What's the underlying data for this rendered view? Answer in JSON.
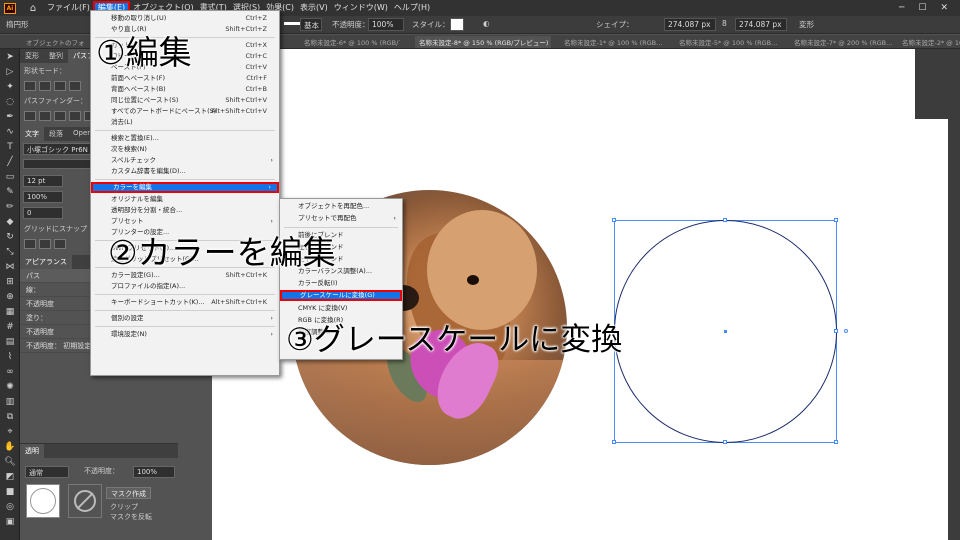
{
  "menubar": {
    "app_logo": "Ai",
    "items": [
      "ファイル(F)",
      "編集(E)",
      "オブジェクト(O)",
      "書式(T)",
      "選択(S)",
      "効果(C)",
      "表示(V)",
      "ウィンドウ(W)",
      "ヘルプ(H)"
    ],
    "active_index": 1
  },
  "controlbar": {
    "left_label": "楕円形",
    "stroke_type": "基本",
    "opacity_label": "不透明度：",
    "opacity_value": "100%",
    "style_label": "スタイル：",
    "shape_label": "シェイプ：",
    "width_value": "274.087 px",
    "height_value": "274.087 px",
    "transform_label": "変形"
  },
  "doc_tabs": [
    "オブジェクトのフォト...",
    "名称未設定-6* @ 100 % (RGB/プ...",
    "名称未設定-8* @ 150 % (RGB/プレビュー)",
    "名称未設定-1* @ 100 % (RGB...",
    "名称未設定-5* @ 100 % (RGB...",
    "名称未設定-7* @ 200 % (RGB...",
    "名称未設定-2* @ 100 % (RGB..."
  ],
  "left_panel": {
    "tabs": [
      "変形",
      "整列",
      "パスファ"
    ],
    "shape_mode_label": "形状モード：",
    "pathfinder_label": "パスファインダー：",
    "type_tabs": [
      "文字",
      "段落",
      "Open"
    ],
    "font_name": "小塚ゴシック Pr6N",
    "font_size": "12 pt",
    "scale": "100%",
    "tracking": "0",
    "snap_label": "グリッドにスナップ",
    "appearance_tab": "アピアランス",
    "appearance_rows": [
      {
        "label": "パス",
        "kind": "header"
      },
      {
        "label": "線：",
        "kind": "row"
      },
      {
        "label": "不透明度",
        "kind": "row"
      },
      {
        "label": "塗り：",
        "kind": "row"
      },
      {
        "label": "不透明度",
        "kind": "row"
      },
      {
        "label": "不透明度：  初期設定",
        "kind": "row"
      }
    ],
    "transparency_tab": "透明",
    "blend_mode": "通常",
    "transparency_opacity_label": "不透明度：",
    "transparency_opacity_value": "100%",
    "mask_button": "マスク作成",
    "clip_label": "クリップ",
    "invert_label": "マスクを反転"
  },
  "edit_menu": {
    "items": [
      {
        "label": "移動の取り消し(U)",
        "shortcut": "Ctrl+Z"
      },
      {
        "label": "やり直し(R)",
        "shortcut": "Shift+Ctrl+Z"
      },
      {
        "sep": true
      },
      {
        "label": "カット(T)",
        "shortcut": "Ctrl+X"
      },
      {
        "label": "コピー(C)",
        "shortcut": "Ctrl+C"
      },
      {
        "label": "ペースト(P)",
        "shortcut": "Ctrl+V"
      },
      {
        "label": "前面へペースト(F)",
        "shortcut": "Ctrl+F"
      },
      {
        "label": "背面へペースト(B)",
        "shortcut": "Ctrl+B"
      },
      {
        "label": "同じ位置にペースト(S)",
        "shortcut": "Shift+Ctrl+V"
      },
      {
        "label": "すべてのアートボードにペースト(S)",
        "shortcut": "Alt+Shift+Ctrl+V"
      },
      {
        "label": "消去(L)",
        "shortcut": ""
      },
      {
        "sep": true
      },
      {
        "label": "検索と置換(E)...",
        "shortcut": ""
      },
      {
        "label": "次を検索(N)",
        "shortcut": ""
      },
      {
        "label": "スペルチェック",
        "shortcut": "",
        "submenu": true
      },
      {
        "label": "カスタム辞書を編集(D)...",
        "shortcut": ""
      },
      {
        "sep": true
      },
      {
        "label": "カラーを編集",
        "shortcut": "",
        "submenu": true,
        "highlighted": true
      },
      {
        "label": "オリジナルを編集",
        "shortcut": ""
      },
      {
        "label": "透明部分を分割・統合...",
        "shortcut": ""
      },
      {
        "label": "プリセット",
        "shortcut": "",
        "submenu": true
      },
      {
        "label": "プリンターの設定...",
        "shortcut": ""
      },
      {
        "sep": true
      },
      {
        "label": "SWF プリセット(S)...",
        "shortcut": ""
      },
      {
        "label": "遠近グリッドプリセット(G)...",
        "shortcut": ""
      },
      {
        "sep": true
      },
      {
        "label": "カラー設定(G)...",
        "shortcut": "Shift+Ctrl+K"
      },
      {
        "label": "プロファイルの指定(A)...",
        "shortcut": ""
      },
      {
        "sep": true
      },
      {
        "label": "キーボードショートカット(K)...",
        "shortcut": "Alt+Shift+Ctrl+K"
      },
      {
        "sep": true
      },
      {
        "label": "個別の設定",
        "shortcut": "",
        "submenu": true
      },
      {
        "sep": true
      },
      {
        "label": "環境設定(N)",
        "shortcut": "",
        "submenu": true
      }
    ]
  },
  "color_submenu": {
    "items": [
      {
        "label": "オブジェクトを再配色..."
      },
      {
        "label": "プリセットで再配色",
        "submenu": true
      },
      {
        "sep": true
      },
      {
        "label": "前後にブレンド"
      },
      {
        "label": "左右にブレンド"
      },
      {
        "label": "上下にブレンド"
      },
      {
        "label": "カラーバランス調整(A)..."
      },
      {
        "label": "カラー反転(I)"
      },
      {
        "label": "グレースケールに変換(G)",
        "highlighted": true
      },
      {
        "label": "CMYK に変換(V)"
      },
      {
        "label": "RGB に変換(R)"
      },
      {
        "label": "彩度調整..."
      }
    ]
  },
  "annotations": {
    "step1": "①編集",
    "step2": "②カラーを編集",
    "step3": "③グレースケールに変換"
  },
  "colors": {
    "highlight": "#1473e6",
    "callout_border": "#e00000",
    "selection": "#4a8cf7"
  }
}
